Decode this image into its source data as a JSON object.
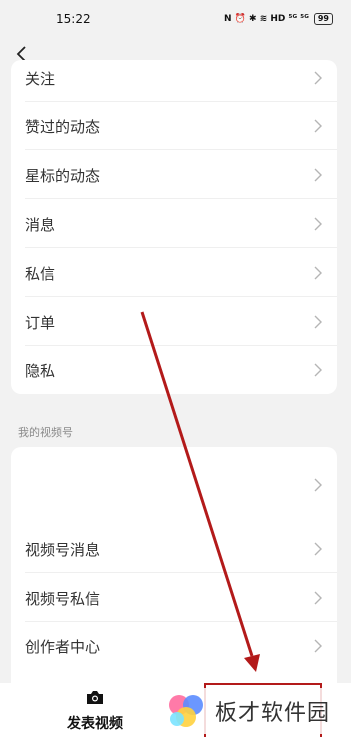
{
  "status_bar": {
    "time": "15:22",
    "icons_text": "N ⏰ ✱ ≋ HD ⁵ᴳ ⁵ᴳ",
    "battery": "99"
  },
  "nav": {
    "back_icon": "chevron-left-icon"
  },
  "settings_list": {
    "items": [
      {
        "label": "关注"
      },
      {
        "label": "赞过的动态"
      },
      {
        "label": "星标的动态"
      },
      {
        "label": "消息"
      },
      {
        "label": "私信"
      },
      {
        "label": "订单"
      },
      {
        "label": "隐私"
      }
    ]
  },
  "channels_section": {
    "title": "我的视频号",
    "items": [
      {
        "label": ""
      },
      {
        "label": "视频号消息"
      },
      {
        "label": "视频号私信"
      },
      {
        "label": "创作者中心"
      }
    ]
  },
  "bottom_bar": {
    "publish_label": "发表视频",
    "publish_icon": "camera-icon"
  },
  "watermark": {
    "text": "板才软件园"
  },
  "colors": {
    "annotation_red": "#b31a1a",
    "background": "#f2f2f2"
  }
}
